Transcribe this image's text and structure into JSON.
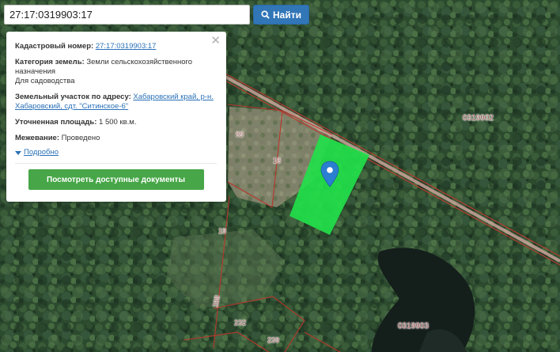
{
  "search": {
    "value": "27:17:0319903:17",
    "button_label": "Найти"
  },
  "popup": {
    "cadastral_label": "Кадастровый номер:",
    "cadastral_value": "27:17:0319903:17",
    "category_label": "Категория земель:",
    "category_value": "Земли сельскохозяйственного назначения",
    "category_use": "Для садоводства",
    "address_label": "Земельный участок по адресу:",
    "address_value": "Хабаровский край, р-н. Хабаровский, сдт. \"Ситинское-6\"",
    "area_label": "Уточненная площадь:",
    "area_value": "1 500 кв.м.",
    "survey_label": "Межевание:",
    "survey_value": "Проведено",
    "more_label": "Подробно",
    "docs_button": "Посмотреть доступные документы"
  },
  "map_labels": {
    "block_top": "0319902",
    "block_bottom": "0319903",
    "parcel_89": "89",
    "parcel_18": "18",
    "parcel_19": "19",
    "parcel_288": "288",
    "parcel_232": "232",
    "parcel_239": "239"
  },
  "colors": {
    "selected_parcel": "#22e04a",
    "parcel_border": "#c0392b",
    "search_button": "#3176b7",
    "docs_button": "#47a648",
    "marker": "#2b7fd1"
  }
}
